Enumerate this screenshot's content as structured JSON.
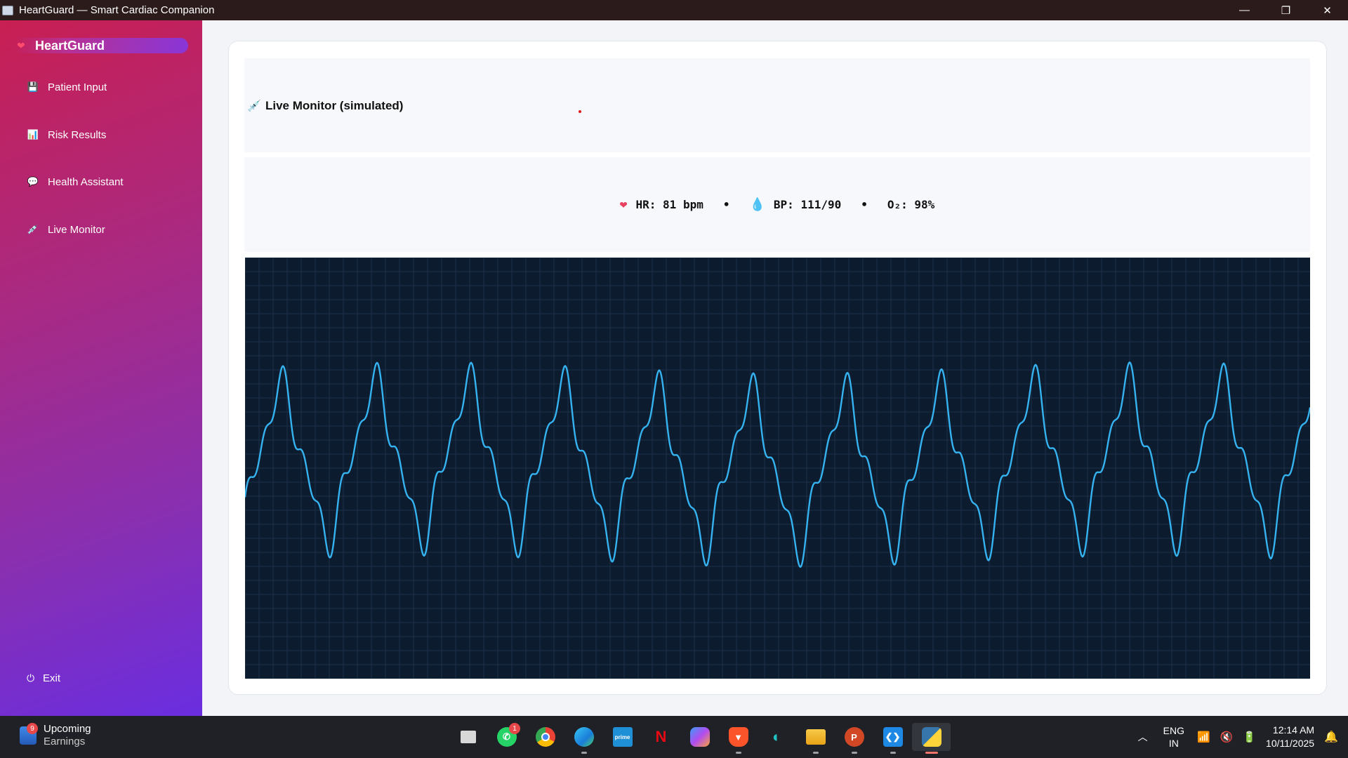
{
  "window": {
    "title": "HeartGuard — Smart Cardiac Companion",
    "minimize": "—",
    "restore": "❐",
    "close": "✕"
  },
  "sidebar": {
    "brand": "HeartGuard",
    "items": [
      {
        "label": "Patient Input",
        "icon": "💾"
      },
      {
        "label": "Risk Results",
        "icon": "📊"
      },
      {
        "label": "Health Assistant",
        "icon": "💬"
      },
      {
        "label": "Live Monitor",
        "icon": "💉"
      }
    ],
    "exit_label": "Exit",
    "exit_icon": "⏻"
  },
  "monitor": {
    "title": "Live Monitor (simulated)",
    "title_icon": "💉",
    "vitals": {
      "hr": "HR: 81 bpm",
      "bp": "BP: 111/90",
      "o2": "O₂: 98%",
      "sep": "•"
    },
    "waveform_color": "#35b2f0",
    "grid_color": "#1b3048",
    "background_color": "#0d1b2e"
  },
  "taskbar": {
    "widget_title": "Upcoming",
    "widget_subtitle": "Earnings",
    "widget_badge": "9",
    "whatsapp_badge": "1",
    "lang_1": "ENG",
    "lang_2": "IN",
    "time": "12:14 AM",
    "date": "10/11/2025"
  }
}
